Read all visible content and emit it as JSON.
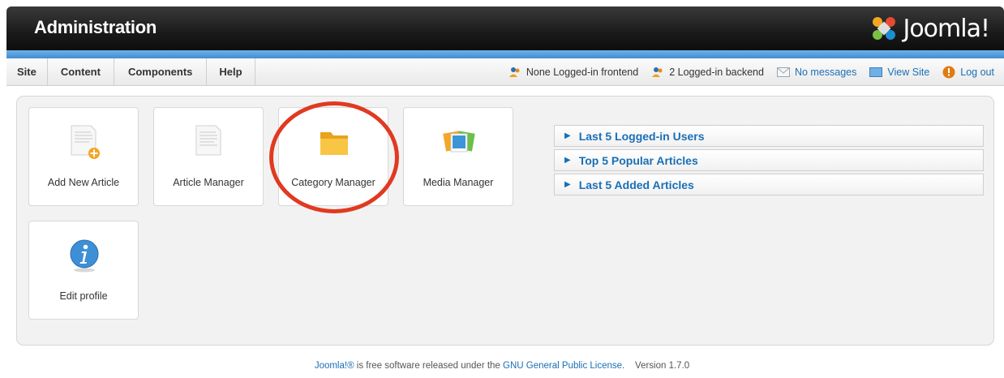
{
  "header": {
    "title": "Administration",
    "logo_text": "Joomla!"
  },
  "menu": {
    "items": [
      "Site",
      "Content",
      "Components",
      "Help"
    ]
  },
  "status": {
    "frontend": "None Logged-in frontend",
    "backend": "2 Logged-in backend",
    "messages": "No messages",
    "view_site": "View Site",
    "logout": "Log out"
  },
  "buttons": [
    {
      "label": "Add New Article",
      "icon": "add-article-icon"
    },
    {
      "label": "Article Manager",
      "icon": "article-icon"
    },
    {
      "label": "Category Manager",
      "icon": "folder-icon"
    },
    {
      "label": "Media Manager",
      "icon": "media-icon"
    },
    {
      "label": "Edit profile",
      "icon": "info-icon"
    }
  ],
  "accordion": [
    "Last 5 Logged-in Users",
    "Top 5 Popular Articles",
    "Last 5 Added Articles"
  ],
  "footer": {
    "joomla": "Joomla!®",
    "text_mid": " is free software released under the ",
    "license": "GNU General Public License",
    "version": "Version 1.7.0"
  },
  "colors": {
    "accent": "#1a6fb5",
    "highlight": "#e03a20",
    "header_bg": "#1a1a1a"
  }
}
